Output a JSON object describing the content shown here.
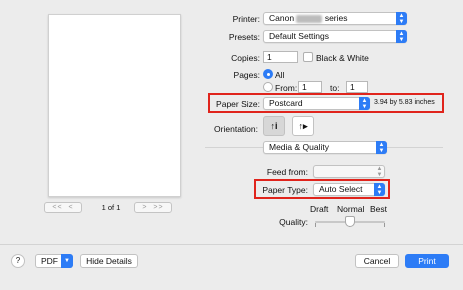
{
  "preview": {
    "page_indicator": "1 of 1",
    "nav_first": "<<",
    "nav_prev": "<",
    "nav_next": ">",
    "nav_last": ">>"
  },
  "printer": {
    "label": "Printer:",
    "value_prefix": "Canon",
    "value_suffix": "series"
  },
  "presets": {
    "label": "Presets:",
    "value": "Default Settings"
  },
  "copies": {
    "label": "Copies:",
    "value": "1",
    "bw_label": "Black & White"
  },
  "pages": {
    "label": "Pages:",
    "all_label": "All",
    "from_label": "From:",
    "from_value": "1",
    "to_label": "to:",
    "to_value": "1"
  },
  "paper_size": {
    "label": "Paper Size:",
    "value": "Postcard",
    "dimensions": "3.94 by 5.83 inches"
  },
  "orientation": {
    "label": "Orientation:",
    "portrait_glyph": "↑i",
    "landscape_glyph": "↑▸"
  },
  "section": {
    "value": "Media & Quality"
  },
  "feed_from": {
    "label": "Feed from:",
    "value": ""
  },
  "paper_type": {
    "label": "Paper Type:",
    "value": "Auto Select"
  },
  "quality": {
    "label": "Quality:",
    "draft": "Draft",
    "normal": "Normal",
    "best": "Best",
    "level": 0.5
  },
  "footer": {
    "help": "?",
    "pdf": "PDF",
    "hide_details": "Hide Details",
    "cancel": "Cancel",
    "print": "Print"
  },
  "colors": {
    "accent": "#2d7cf6",
    "highlight": "#e0241c"
  }
}
